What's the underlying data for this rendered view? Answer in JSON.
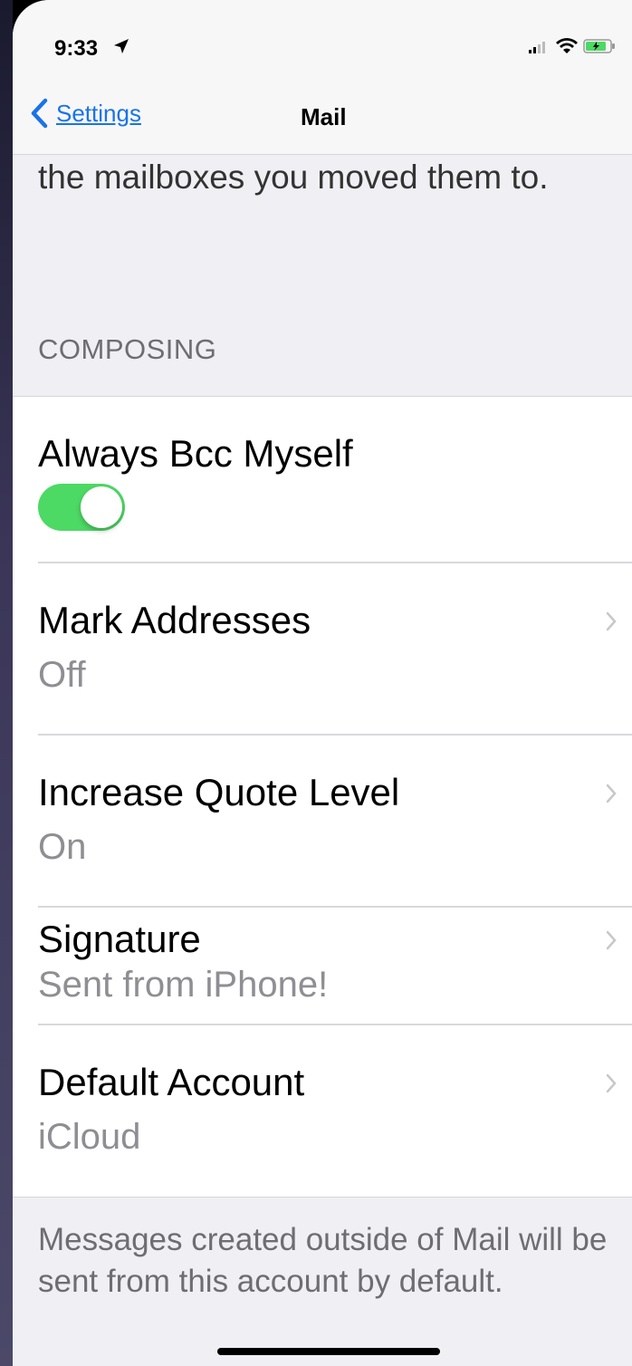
{
  "status_bar": {
    "time": "9:33",
    "location_icon": "location-arrow-icon",
    "signal_icon": "cellular-signal-icon",
    "wifi_icon": "wifi-icon",
    "battery_icon": "battery-charging-icon",
    "battery_color": "#4cd964"
  },
  "nav": {
    "back_label": "Settings",
    "title": "Mail"
  },
  "intro_text": "the mailboxes you moved them to.",
  "section_header": "COMPOSING",
  "rows": [
    {
      "title": "Always Bcc Myself",
      "toggle_on": true
    },
    {
      "title": "Mark Addresses",
      "value": "Off"
    },
    {
      "title": "Increase Quote Level",
      "value": "On"
    },
    {
      "title": "Signature",
      "value": "Sent from iPhone!"
    },
    {
      "title": "Default Account",
      "value": "iCloud"
    }
  ],
  "footer_text": "Messages created outside of Mail will be sent from this account by default.",
  "colors": {
    "accent": "#1a73e8",
    "toggle_on": "#4cd964",
    "secondary_text": "#8e8e93",
    "background": "#efeff4"
  }
}
